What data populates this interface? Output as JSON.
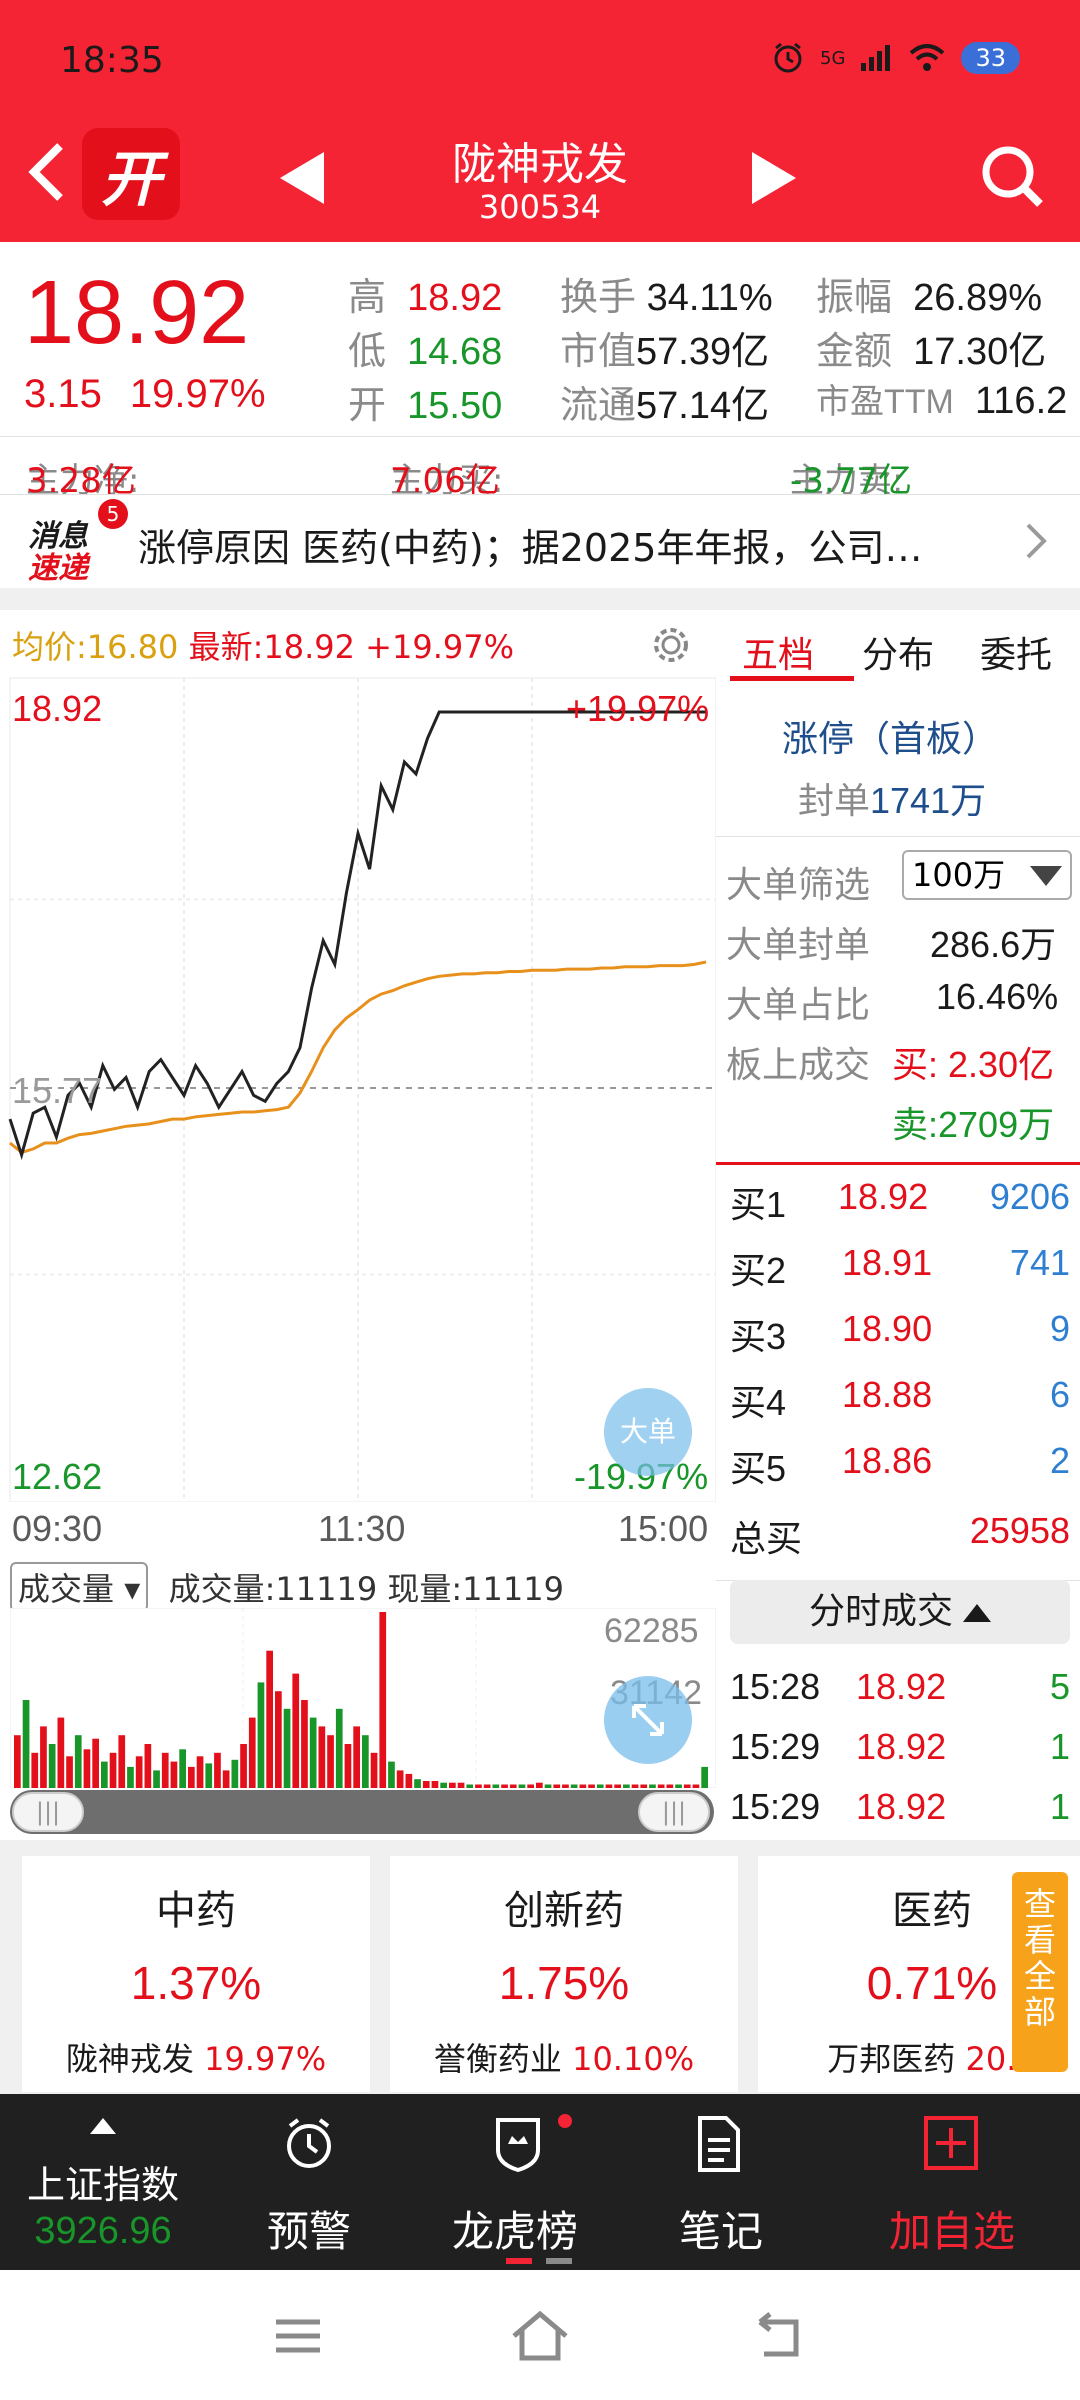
{
  "status_bar": {
    "time": "18:35",
    "network": "5G",
    "battery": "33"
  },
  "header": {
    "logo_text": "开",
    "stock_name": "陇神戎发",
    "stock_code": "300534"
  },
  "quote": {
    "price": "18.92",
    "change": "3.15",
    "change_pct": "19.97%",
    "stats": [
      {
        "label": "高",
        "value": "18.92",
        "color": "#e3101c"
      },
      {
        "label": "低",
        "value": "14.68",
        "color": "#18962a"
      },
      {
        "label": "开",
        "value": "15.50",
        "color": "#18962a"
      },
      {
        "label": "换手",
        "value": "34.11%",
        "color": "#1a1a1a"
      },
      {
        "label": "市值",
        "value": "57.39亿",
        "color": "#1a1a1a"
      },
      {
        "label": "流通",
        "value": "57.14亿",
        "color": "#1a1a1a"
      },
      {
        "label": "振幅",
        "value": "26.89%",
        "color": "#1a1a1a"
      },
      {
        "label": "金额",
        "value": "17.30亿",
        "color": "#1a1a1a"
      },
      {
        "label": "市盈TTM",
        "value": "116.2",
        "color": "#1a1a1a"
      }
    ]
  },
  "fund_flow": {
    "net_label": "主力净:",
    "net_value": "3.28亿",
    "buy_label": "主力买:",
    "buy_value": "7.06亿",
    "sell_label": "主力卖:",
    "sell_value": "-3.77亿"
  },
  "news": {
    "logo_top": "消息",
    "logo_bottom": "速递",
    "badge": "5",
    "text": "涨停原因   医药(中药)；据2025年年报，公司…"
  },
  "chart_header": {
    "avg_label": "均价:16.80",
    "latest_label": "最新:18.92",
    "latest_pct": "+19.97%"
  },
  "chart_data": {
    "type": "line",
    "y_axis": {
      "top": "18.92",
      "mid": "15.77",
      "bottom": "12.62",
      "ylim": [
        12.62,
        18.92
      ]
    },
    "y_axis_right": {
      "top": "+19.97%",
      "bottom": "-19.97%"
    },
    "x_labels": [
      "09:30",
      "11:30",
      "15:00"
    ],
    "series": [
      {
        "color": "#222222",
        "values": [
          15.5,
          15.2,
          15.55,
          15.6,
          15.35,
          15.7,
          15.8,
          15.6,
          15.95,
          15.75,
          15.85,
          15.6,
          15.9,
          16.0,
          15.85,
          15.7,
          15.95,
          15.8,
          15.6,
          15.75,
          15.9,
          15.7,
          15.65,
          15.8,
          15.9,
          16.1,
          16.6,
          17.0,
          16.8,
          17.4,
          17.9,
          17.6,
          18.3,
          18.1,
          18.5,
          18.4,
          18.7,
          18.92,
          18.92,
          18.92,
          18.92,
          18.92,
          18.92,
          18.92,
          18.92,
          18.92,
          18.92,
          18.92,
          18.92,
          18.92,
          18.92,
          18.92,
          18.92,
          18.92,
          18.92,
          18.92,
          18.92,
          18.92,
          18.92,
          18.92,
          18.92
        ]
      },
      {
        "color": "#e8901c",
        "values": [
          15.3,
          15.22,
          15.25,
          15.3,
          15.3,
          15.34,
          15.37,
          15.38,
          15.4,
          15.42,
          15.44,
          15.45,
          15.46,
          15.48,
          15.5,
          15.5,
          15.52,
          15.53,
          15.54,
          15.55,
          15.56,
          15.56,
          15.57,
          15.58,
          15.6,
          15.72,
          15.9,
          16.1,
          16.25,
          16.35,
          16.42,
          16.5,
          16.55,
          16.58,
          16.62,
          16.65,
          16.68,
          16.7,
          16.71,
          16.72,
          16.72,
          16.73,
          16.73,
          16.74,
          16.74,
          16.75,
          16.75,
          16.75,
          16.76,
          16.76,
          16.76,
          16.77,
          16.77,
          16.78,
          16.78,
          16.78,
          16.79,
          16.79,
          16.79,
          16.8,
          16.82
        ]
      }
    ],
    "volume": {
      "label": "成交量",
      "total_label": "成交量:11119",
      "current_label": "现量:11119",
      "max_label": "62285",
      "mid_label": "31142",
      "bars": [
        0.3,
        0.5,
        0.2,
        0.35,
        0.25,
        0.4,
        0.18,
        0.3,
        0.22,
        0.28,
        0.15,
        0.2,
        0.3,
        0.12,
        0.18,
        0.25,
        0.1,
        0.2,
        0.15,
        0.22,
        0.12,
        0.18,
        0.14,
        0.2,
        0.1,
        0.16,
        0.25,
        0.4,
        0.6,
        0.78,
        0.55,
        0.45,
        0.65,
        0.5,
        0.4,
        0.35,
        0.3,
        0.45,
        0.25,
        0.35,
        0.3,
        0.2,
        1.0,
        0.15,
        0.1,
        0.08,
        0.05,
        0.04,
        0.04,
        0.03,
        0.03,
        0.03,
        0.02,
        0.02,
        0.02,
        0.02,
        0.02,
        0.02,
        0.02,
        0.02,
        0.03,
        0.02,
        0.02,
        0.02,
        0.02,
        0.02,
        0.02,
        0.02,
        0.02,
        0.02,
        0.02,
        0.02,
        0.02,
        0.02,
        0.02,
        0.02,
        0.02,
        0.02,
        0.02,
        0.12
      ]
    },
    "floating_button": "大单"
  },
  "right_panel": {
    "tabs": [
      "五档",
      "分布",
      "委托"
    ],
    "limit_status": "涨停（首板）",
    "seal_label": "封单",
    "seal_value": "1741万",
    "filter_label": "大单筛选",
    "filter_value": "100万",
    "big_seal_label": "大单封单",
    "big_seal_value": "286.6万",
    "big_ratio_label": "大单占比",
    "big_ratio_value": "16.46%",
    "board_deal_label": "板上成交",
    "board_buy": "买: 2.30亿",
    "board_sell": "卖:2709万",
    "bids": [
      {
        "label": "买1",
        "price": "18.92",
        "vol": "9206"
      },
      {
        "label": "买2",
        "price": "18.91",
        "vol": "741"
      },
      {
        "label": "买3",
        "price": "18.90",
        "vol": "9"
      },
      {
        "label": "买4",
        "price": "18.88",
        "vol": "6"
      },
      {
        "label": "买5",
        "price": "18.86",
        "vol": "2"
      }
    ],
    "total_buy_label": "总买",
    "total_buy_value": "25958",
    "tick_button": "分时成交",
    "ticks": [
      {
        "time": "15:28",
        "price": "18.92",
        "vol": "5"
      },
      {
        "time": "15:29",
        "price": "18.92",
        "vol": "1"
      },
      {
        "time": "15:29",
        "price": "18.92",
        "vol": "1"
      }
    ]
  },
  "sectors": [
    {
      "name": "中药",
      "pct": "1.37%",
      "leader": "陇神戎发",
      "leader_pct": "19.97%"
    },
    {
      "name": "创新药",
      "pct": "1.75%",
      "leader": "誉衡药业",
      "leader_pct": "10.10%"
    },
    {
      "name": "医药",
      "pct": "0.71%",
      "leader": "万邦医药",
      "leader_pct": "20.0"
    }
  ],
  "view_all": "查看全部",
  "bottom_nav": {
    "index_name": "上证指数",
    "index_value": "3926.96",
    "items": [
      "预警",
      "龙虎榜",
      "笔记",
      "加自选"
    ]
  },
  "colors": {
    "brand_red": "#f42434",
    "up": "#e3101c",
    "down": "#18962a",
    "accent_orange": "#f7a21b"
  }
}
